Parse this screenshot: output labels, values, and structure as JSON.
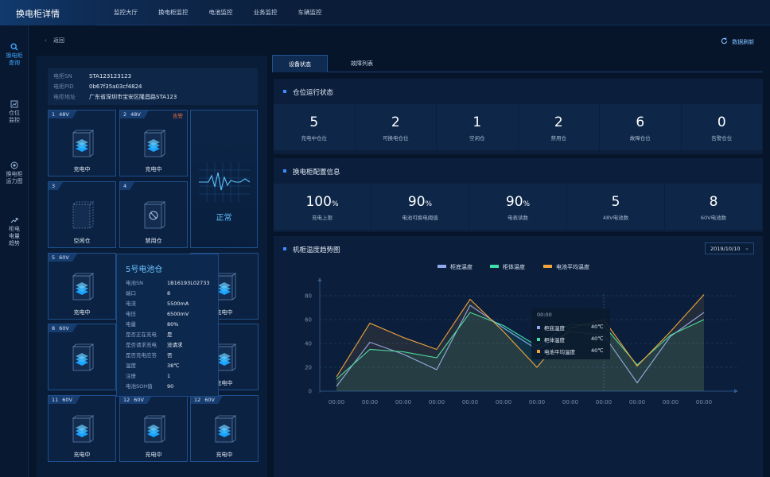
{
  "app": {
    "title": "换电柜详情"
  },
  "nav": [
    "监控大厅",
    "换电柜监控",
    "电池监控",
    "业务监控",
    "车辆监控"
  ],
  "sidebar": [
    {
      "label1": "换电柜",
      "label2": "查询"
    },
    {
      "label1": "仓位",
      "label2": "监控"
    },
    {
      "label1": "换电柜",
      "label2": "运力图"
    },
    {
      "label1": "柜电",
      "label2": "电量",
      "label3": "趋势"
    }
  ],
  "header": {
    "back": "返回",
    "refresh": "数据刷新"
  },
  "cabinet": {
    "sn_key": "电柜SN",
    "sn": "STA123123123",
    "pid_key": "电柜PID",
    "pid": "0b67f35a03cf4824",
    "addr_key": "电柜地址",
    "addr": "广东省深圳市宝安区隆昌路STA123"
  },
  "cells": [
    {
      "num": "1",
      "volt": "48V",
      "label": "充电中",
      "warn": ""
    },
    {
      "num": "2",
      "volt": "48V",
      "label": "充电中",
      "warn": "告警"
    },
    {
      "num": "3",
      "volt": "",
      "label": "空闲仓",
      "warn": ""
    },
    {
      "num": "4",
      "volt": "",
      "label": "禁用仓",
      "warn": ""
    },
    {
      "num": "5",
      "volt": "60V",
      "label": "充电中",
      "warn": ""
    },
    {
      "num": "",
      "volt": "",
      "label": "充电中",
      "warn": ""
    },
    {
      "num": "8",
      "volt": "60V",
      "label": "",
      "warn": ""
    },
    {
      "num": "",
      "volt": "",
      "label": "充电中",
      "warn": ""
    },
    {
      "num": "11",
      "volt": "60V",
      "label": "充电中",
      "warn": ""
    },
    {
      "num": "12",
      "volt": "60V",
      "label": "充电中",
      "warn": ""
    },
    {
      "num": "12",
      "volt": "60V",
      "label": "充电中",
      "warn": ""
    }
  ],
  "status": {
    "text": "正常"
  },
  "popup": {
    "title": "5号电池仓",
    "rows": [
      {
        "k": "电池SN",
        "v": "1B16193L02733"
      },
      {
        "k": "端口",
        "v": "8"
      },
      {
        "k": "电流",
        "v": "5500mA"
      },
      {
        "k": "电压",
        "v": "6500mV"
      },
      {
        "k": "电量",
        "v": "80%"
      },
      {
        "k": "是否正在充电",
        "v": "是"
      },
      {
        "k": "是否请求充电",
        "v": "没请求"
      },
      {
        "k": "是否充电应答",
        "v": "否"
      },
      {
        "k": "温度",
        "v": "38℃"
      },
      {
        "k": "注册",
        "v": "1"
      },
      {
        "k": "电池SOH值",
        "v": "90"
      }
    ]
  },
  "tabs": [
    "设备状态",
    "故障列表"
  ],
  "run_status": {
    "title": "仓位运行状态",
    "items": [
      {
        "value": "5",
        "label": "充电中仓位"
      },
      {
        "value": "2",
        "label": "可换电仓位"
      },
      {
        "value": "1",
        "label": "空闲仓"
      },
      {
        "value": "2",
        "label": "禁用仓"
      },
      {
        "value": "6",
        "label": "故障仓位"
      },
      {
        "value": "0",
        "label": "告警仓位"
      }
    ]
  },
  "config": {
    "title": "换电柜配置信息",
    "items": [
      {
        "value": "100",
        "unit": "%",
        "label": "充电上限"
      },
      {
        "value": "90",
        "unit": "%",
        "label": "电池可换电阈值"
      },
      {
        "value": "90",
        "unit": "%",
        "label": "电表读数"
      },
      {
        "value": "5",
        "unit": "",
        "label": "48V电池数"
      },
      {
        "value": "8",
        "unit": "",
        "label": "60V电池数"
      }
    ]
  },
  "trend": {
    "title": "机柜温度趋势图",
    "date": "2019/10/10"
  },
  "colors": {
    "accent": "#3fa6ff",
    "series1": "#8fa8f0",
    "series2": "#3de0a8",
    "series3": "#f2a33a",
    "warn": "#e06a4b"
  },
  "chart_data": {
    "type": "line",
    "x": [
      "00:00",
      "00:00",
      "00:00",
      "00:00",
      "00:00",
      "00:00",
      "00:00",
      "00:00",
      "00:00",
      "00:00",
      "00:00",
      "00:00"
    ],
    "ylim": [
      0,
      80
    ],
    "yticks": [
      0,
      20,
      40,
      60,
      80
    ],
    "legend_position": "top-center",
    "series": [
      {
        "name": "柜底温度",
        "color": "#8fa8f0",
        "values": [
          4,
          41,
          31,
          18,
          72,
          53,
          35,
          50,
          47,
          7,
          46,
          66
        ]
      },
      {
        "name": "柜体温度",
        "color": "#3de0a8",
        "values": [
          10,
          35,
          33,
          28,
          66,
          55,
          38,
          56,
          55,
          22,
          47,
          60
        ]
      },
      {
        "name": "电池平均温度",
        "color": "#f2a33a",
        "values": [
          12,
          57,
          45,
          35,
          77,
          50,
          20,
          53,
          60,
          21,
          50,
          81
        ]
      }
    ],
    "tooltip": {
      "title": "00:00",
      "rows": [
        {
          "name": "柜底温度",
          "value": "40℃"
        },
        {
          "name": "柜体温度",
          "value": "40℃"
        },
        {
          "name": "电池平均温度",
          "value": "40℃"
        }
      ]
    }
  }
}
